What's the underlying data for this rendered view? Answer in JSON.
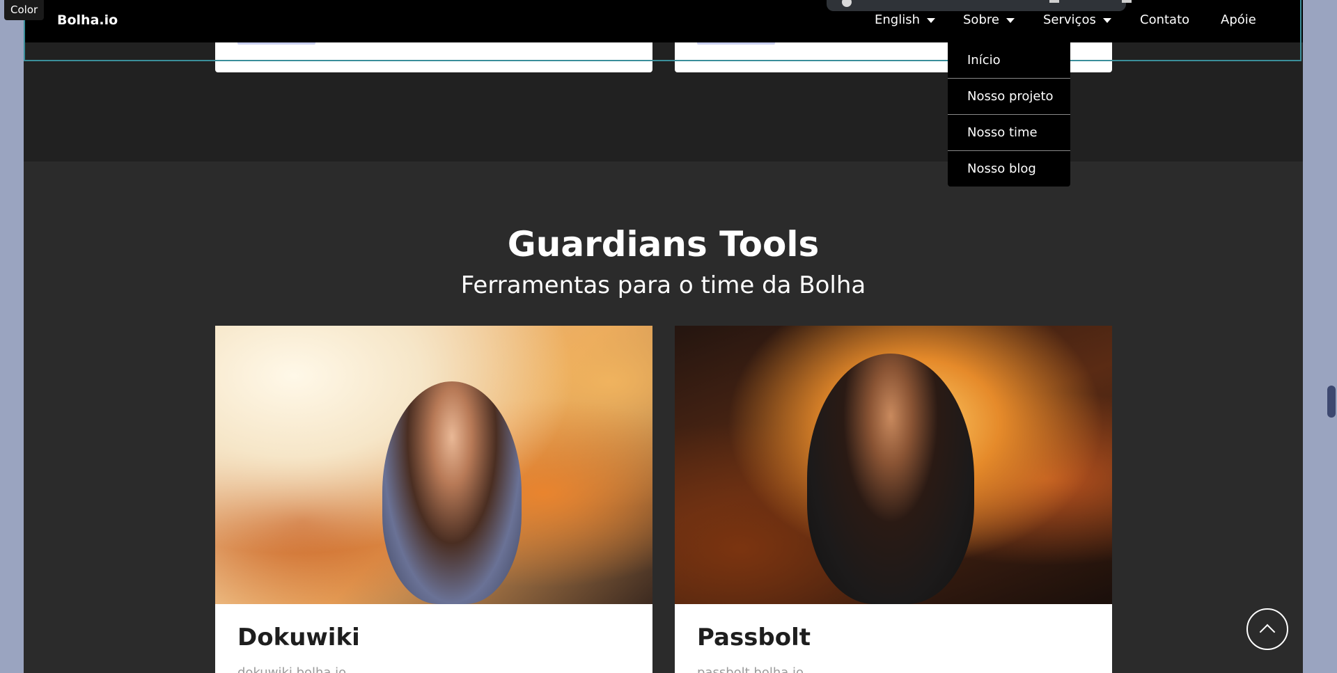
{
  "tooltip": {
    "color_label": "Color"
  },
  "navbar": {
    "brand": "Bolha.io",
    "items": [
      {
        "label": "English"
      },
      {
        "label": "Sobre"
      },
      {
        "label": "Serviços"
      },
      {
        "label": "Contato"
      },
      {
        "label": "Apóie"
      }
    ],
    "sobre_dropdown": [
      "Início",
      "Nosso projeto",
      "Nosso time",
      "Nosso blog"
    ]
  },
  "section": {
    "title": "Guardians Tools",
    "subtitle": "Ferramentas para o time da Bolha"
  },
  "cards": [
    {
      "title": "Dokuwiki",
      "subtitle": "dokuwiki.bolha.io"
    },
    {
      "title": "Passbolt",
      "subtitle": "passbolt.bolha.io"
    }
  ],
  "colors": {
    "nav_background": "#000000",
    "section_background": "#2b2b2b",
    "upper_band": "#212121",
    "outline": "#3a8e9a",
    "page_gutter": "#9aa4c0"
  },
  "icons": {
    "scroll_top": "chevron-up-icon",
    "dropdown_caret": "caret-down-icon"
  }
}
